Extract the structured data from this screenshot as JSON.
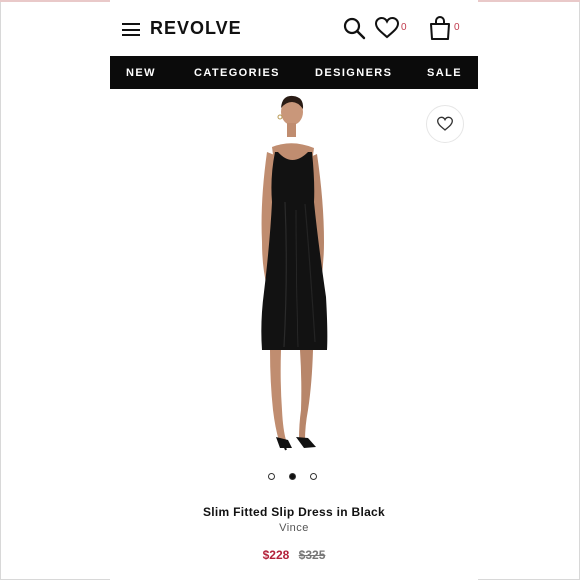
{
  "header": {
    "logo": "REVOLVE",
    "favorites_count": "0",
    "bag_count": "0",
    "icons": [
      "menu-icon",
      "search-icon",
      "heart-icon",
      "bag-icon"
    ]
  },
  "nav": {
    "items": [
      "NEW",
      "CATEGORIES",
      "DESIGNERS",
      "SALE"
    ]
  },
  "product": {
    "name": "Slim Fitted Slip Dress in Black",
    "brand": "Vince",
    "sale_price": "$228",
    "original_price": "$325",
    "carousel": {
      "total": 3,
      "active_index": 2
    }
  },
  "colors": {
    "accent": "#b3213a",
    "nav_bg": "#0b0b0b",
    "count": "#c03a4c"
  }
}
